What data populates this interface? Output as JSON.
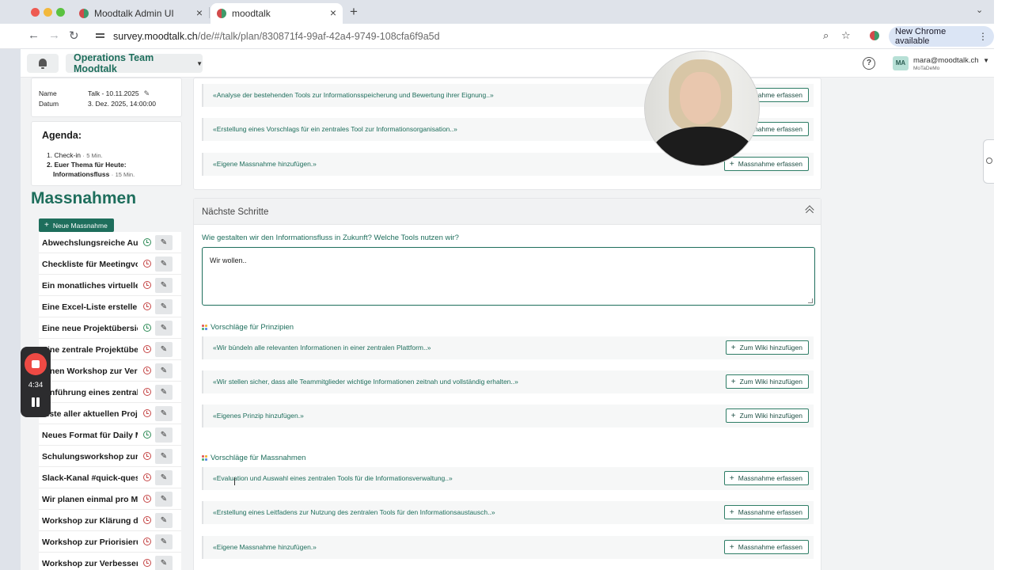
{
  "browser": {
    "tabs": [
      {
        "label": "Moodtalk Admin UI",
        "active": false
      },
      {
        "label": "moodtalk",
        "active": true
      }
    ],
    "url_host": "survey.moodtalk.ch",
    "url_path": "/de/#/talk/plan/830871f4-99af-42a4-9749-108cfa6f9a5d",
    "update_button": "New Chrome available"
  },
  "header": {
    "team": "Operations Team Moodtalk",
    "user_initials": "MA",
    "user_email": "mara@moodtalk.ch",
    "user_org": "MoTaDeMo"
  },
  "meta": {
    "name_label": "Name",
    "name_value": "Talk - 10.11.2025",
    "date_label": "Datum",
    "date_value": "3. Dez. 2025, 14:00:00"
  },
  "agenda": {
    "title": "Agenda:",
    "items": [
      {
        "text": "1. Check-in",
        "duration": "5  Min."
      },
      {
        "text": "2. Euer Thema für Heute:",
        "text2": "Informationsfluss",
        "duration": "15  Min."
      }
    ]
  },
  "massnahmen": {
    "title": "Massnahmen",
    "new_button": "Neue Massnahme",
    "items": [
      {
        "label": "Abwechslungsreiche Auf…",
        "status": "green"
      },
      {
        "label": "Checkliste für Meetingvor…",
        "status": "red"
      },
      {
        "label": "Ein monatliches virtuelles…",
        "status": "red"
      },
      {
        "label": "Eine Excel-Liste erstellen,…",
        "status": "red"
      },
      {
        "label": "Eine neue Projektübersic…",
        "status": "green"
      },
      {
        "label": "Eine zentrale Projektüber…",
        "status": "red"
      },
      {
        "label": "Einen Workshop zur Verbe…",
        "status": "red"
      },
      {
        "label": "Einführung eines zentrale…",
        "status": "red"
      },
      {
        "label": "Liste aller aktuellen Proje…",
        "status": "red"
      },
      {
        "label": "Neues Format für Daily M…",
        "status": "green"
      },
      {
        "label": "Schulungsworkshop zur e…",
        "status": "red"
      },
      {
        "label": "Slack-Kanal #quick-ques…",
        "status": "red"
      },
      {
        "label": "Wir planen einmal pro Mo…",
        "status": "red"
      },
      {
        "label": "Workshop zur Klärung der…",
        "status": "red"
      },
      {
        "label": "Workshop zur Priorisierun…",
        "status": "red"
      },
      {
        "label": "Workshop zur Verbesseru…",
        "status": "red"
      }
    ]
  },
  "top_suggestions": [
    {
      "text": "«Analyse der bestehenden Tools zur Informationsspeicherung und Bewertung ihrer Eignung..»",
      "button": "Massnahme erfassen"
    },
    {
      "text": "«Erstellung eines Vorschlags für ein zentrales Tool zur Informationsorganisation..»",
      "button": "Massnahme erfassen"
    },
    {
      "text": "«Eigene Massnahme hinzufügen.»",
      "button": "Massnahme erfassen"
    }
  ],
  "next_steps": {
    "title": "Nächste Schritte",
    "question": "Wie gestalten wir den Informationsfluss in Zukunft? Welche Tools nutzen wir?",
    "answer": "Wir wollen..",
    "principles_label": "Vorschläge für Prinzipien",
    "principles": [
      {
        "text": "«Wir bündeln alle relevanten Informationen in einer zentralen Plattform..»",
        "button": "Zum Wiki hinzufügen"
      },
      {
        "text": "«Wir stellen sicher, dass alle Teammitglieder wichtige Informationen zeitnah und vollständig erhalten..»",
        "button": "Zum Wiki hinzufügen"
      },
      {
        "text": "«Eigenes Prinzip hinzufügen.»",
        "button": "Zum Wiki hinzufügen"
      }
    ],
    "measures_label": "Vorschläge für Massnahmen",
    "measures": [
      {
        "text": "«Evaluation und Auswahl eines zentralen Tools für die Informationsverwaltung..»",
        "button": "Massnahme erfassen"
      },
      {
        "text": "«Erstellung eines Leitfadens zur Nutzung des zentralen Tools für den Informationsaustausch..»",
        "button": "Massnahme erfassen"
      },
      {
        "text": "«Eigene Massnahme hinzufügen.»",
        "button": "Massnahme erfassen"
      }
    ]
  },
  "recorder": {
    "time": "4:34"
  },
  "colors": {
    "brand": "#1e6e5c",
    "status_green": "#2e8b57",
    "status_red": "#c54545",
    "record_red": "#ee4a44"
  }
}
